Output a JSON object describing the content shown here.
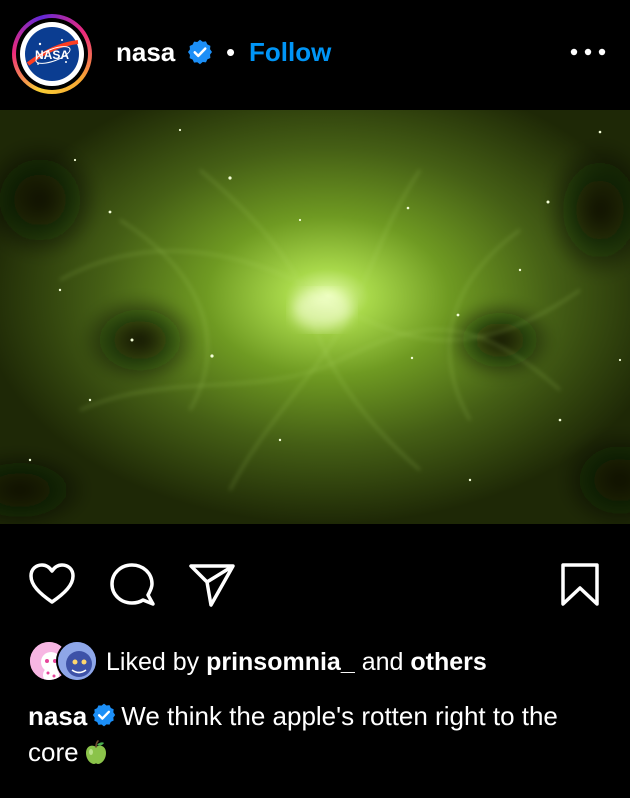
{
  "post": {
    "username": "nasa",
    "separator": "•",
    "follow_label": "Follow",
    "more_icon": "more-horizontal-icon",
    "image_alt": "Green-tinted Crab Nebula image",
    "actions": [
      "heart-icon",
      "comment-icon",
      "share-icon",
      "bookmark-icon"
    ],
    "likes": {
      "prefix": "Liked by",
      "user": "prinsomnia_",
      "middle": "and",
      "others": "others"
    },
    "caption": {
      "username": "nasa",
      "text": "We think the apple's rotten right to the core",
      "emoji": "green-apple"
    }
  },
  "colors": {
    "background": "#000000",
    "link_blue": "#0095f6",
    "verified_blue": "#1c8ff7",
    "text": "#ffffff"
  }
}
